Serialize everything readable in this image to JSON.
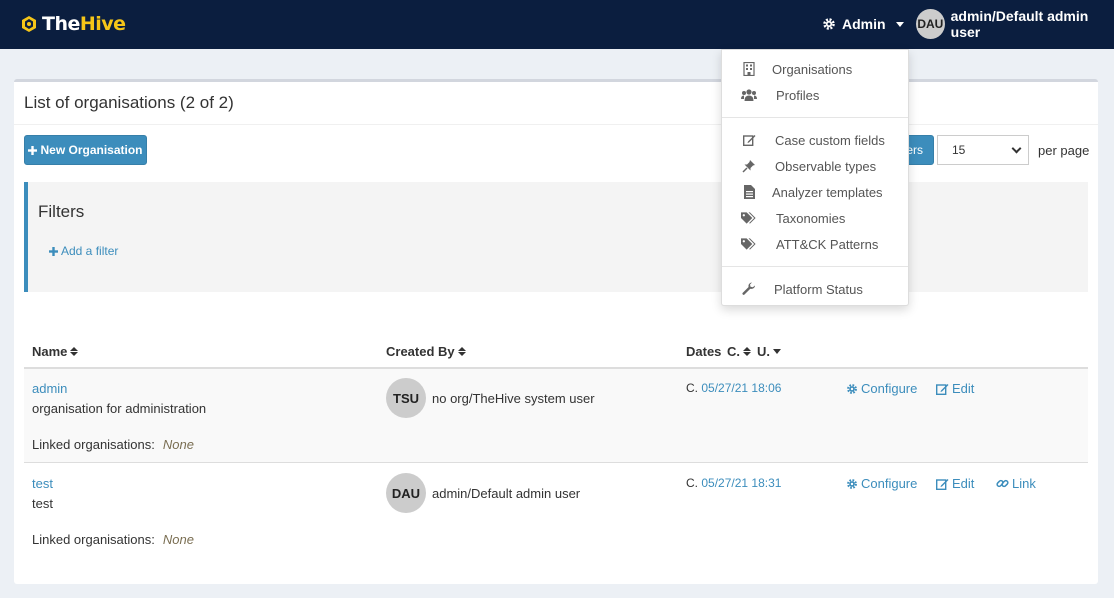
{
  "navbar": {
    "brand_the": "The",
    "brand_hive": "Hive",
    "admin_label": "Admin",
    "user_initials": "DAU",
    "user_label": "admin/Default admin user"
  },
  "panel": {
    "title": "List of organisations (2 of 2)",
    "new_org_label": "New Organisation",
    "filters_button_label": "ers",
    "page_size_value": "15",
    "per_page_label": "per page"
  },
  "filters": {
    "title": "Filters",
    "add_filter_label": "Add a filter"
  },
  "table": {
    "headers": {
      "name": "Name",
      "created_by": "Created By",
      "dates": "Dates",
      "created_short": "C.",
      "updated_short": "U."
    },
    "rows": [
      {
        "name": "admin",
        "description": "organisation for administration",
        "linked_label": "Linked organisations:",
        "linked_value": "None",
        "creator_initials": "TSU",
        "creator": "no org/TheHive system user",
        "date_prefix": "C.",
        "date": "05/27/21 18:06",
        "configure": "Configure",
        "edit": "Edit"
      },
      {
        "name": "test",
        "description": "test",
        "linked_label": "Linked organisations:",
        "linked_value": "None",
        "creator_initials": "DAU",
        "creator": "admin/Default admin user",
        "date_prefix": "C.",
        "date": "05/27/21 18:31",
        "configure": "Configure",
        "edit": "Edit",
        "link": "Link"
      }
    ]
  },
  "admin_menu": {
    "items": [
      {
        "label": "Organisations",
        "icon": "building-icon"
      },
      {
        "label": "Profiles",
        "icon": "users-icon"
      },
      {
        "label": "Case custom fields",
        "icon": "edit-icon"
      },
      {
        "label": "Observable types",
        "icon": "pin-icon"
      },
      {
        "label": "Analyzer templates",
        "icon": "file-icon"
      },
      {
        "label": "Taxonomies",
        "icon": "tags-icon"
      },
      {
        "label": "ATT&CK Patterns",
        "icon": "tags-icon"
      },
      {
        "label": "Platform Status",
        "icon": "wrench-icon"
      }
    ]
  },
  "colors": {
    "navbar_bg": "#0b1e3f",
    "brand_accent": "#f5c518",
    "primary": "#3c8dbc"
  }
}
